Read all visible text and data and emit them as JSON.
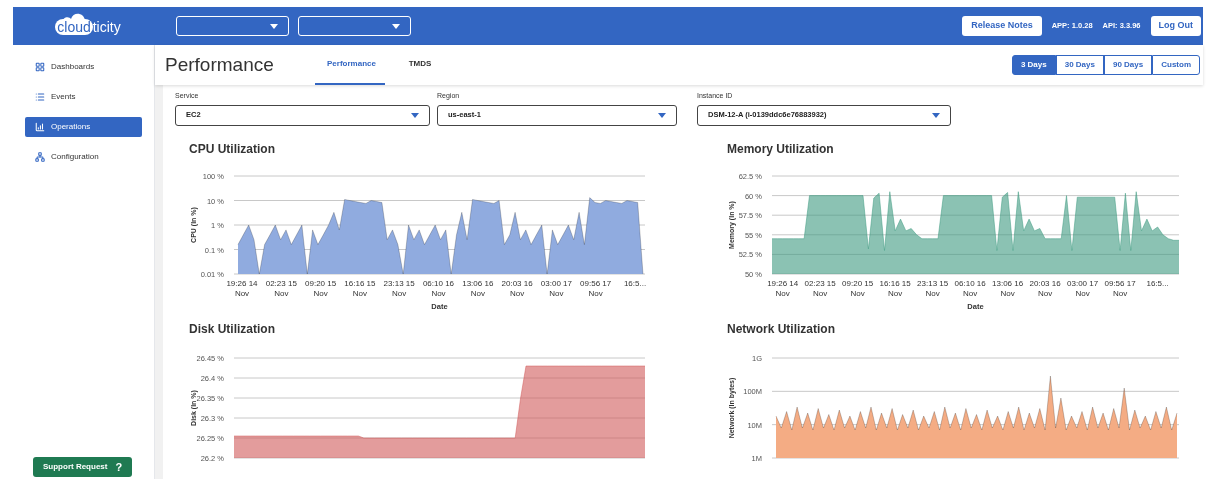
{
  "header": {
    "logo_parts": [
      "cloud",
      "ticity"
    ],
    "release_notes": "Release Notes",
    "app_version": "APP: 1.0.28",
    "api_version": "API: 3.3.96",
    "logout": "Log Out"
  },
  "sidebar": {
    "items": [
      {
        "label": "Dashboards",
        "selected": false
      },
      {
        "label": "Events",
        "selected": false
      },
      {
        "label": "Operations",
        "selected": true
      },
      {
        "label": "Configuration",
        "selected": false
      }
    ],
    "support": {
      "label": "Support Request",
      "icon_text": "?"
    }
  },
  "page": {
    "title": "Performance",
    "tabs": [
      {
        "label": "Performance",
        "selected": true
      },
      {
        "label": "TMDS",
        "selected": false
      }
    ],
    "ranges": [
      {
        "label": "3 Days",
        "selected": true
      },
      {
        "label": "30 Days",
        "selected": false
      },
      {
        "label": "90 Days",
        "selected": false
      },
      {
        "label": "Custom",
        "selected": false
      }
    ]
  },
  "filters": [
    {
      "label": "Service",
      "value": "EC2"
    },
    {
      "label": "Region",
      "value": "us-east-1"
    },
    {
      "label": "Instance ID",
      "value": "DSM-12-A (i-0139ddc6e76883932)"
    }
  ],
  "charts": [
    {
      "kind": "log_chart",
      "title": "CPU Utilization",
      "xlabel": "Date",
      "ylabel": "CPU (In %)",
      "color": "#90abdf",
      "yticks": [
        "100 %",
        "10 %",
        "1 %",
        "0.1 %",
        "0.01 %"
      ],
      "xticks": [
        "19:26 14 Nov",
        "02:23 15 Nov",
        "09:20 15 Nov",
        "16:16 15 Nov",
        "23:13 15 Nov",
        "06:10 16 Nov",
        "13:06 16 Nov",
        "20:03 16 Nov",
        "03:00 17 Nov",
        "09:56 17 Nov",
        "16:5..."
      ]
    },
    {
      "kind": "data_chart",
      "title": "Memory Utilization",
      "chart_data": {
        "type": "area",
        "xlabel": "Date",
        "ylabel": "Memory (In %)",
        "grid": true,
        "ylim": [
          50,
          62.5
        ],
        "categories": [
          null,
          null,
          "19:26 14 Nov",
          null,
          null,
          null,
          null,
          null,
          null,
          "02:23 15 Nov",
          null,
          null,
          null,
          null,
          null,
          null,
          "09:20 15 Nov",
          null,
          null,
          null,
          null,
          null,
          null,
          "16:16 15 Nov",
          null,
          null,
          null,
          null,
          null,
          null,
          "23:13 15 Nov",
          null,
          null,
          null,
          null,
          null,
          null,
          "06:10 16 Nov",
          null,
          null,
          null,
          null,
          null,
          null,
          "13:06 16 Nov",
          null,
          null,
          null,
          null,
          null,
          null,
          "20:03 16 Nov",
          null,
          null,
          null,
          null,
          null,
          null,
          "03:00 17 Nov",
          null,
          null,
          null,
          null,
          null,
          null,
          "09:56 17 Nov",
          null,
          null,
          null,
          null,
          null,
          null,
          "16:5...",
          null,
          null,
          null,
          null
        ],
        "yticks": [
          {
            "value": 50,
            "label": "50 %"
          },
          {
            "value": 52.5,
            "label": "52.5 %"
          },
          {
            "value": 55,
            "label": "55 %"
          },
          {
            "value": 57.5,
            "label": "57.5 %"
          },
          {
            "value": 60,
            "label": "60 %"
          },
          {
            "value": 62.5,
            "label": "62.5 %"
          }
        ],
        "series": [
          {
            "color": "#3e9a80",
            "values": [
              54.5,
              54.5,
              54.5,
              54.5,
              54.5,
              54.5,
              54.5,
              60,
              60,
              60,
              60,
              60,
              60,
              60,
              60,
              60,
              60,
              60,
              53.2,
              59.7,
              60.3,
              53,
              60.5,
              55.5,
              57,
              55.5,
              55.8,
              55,
              54.5,
              54.5,
              54.5,
              54.5,
              60,
              60,
              60,
              60,
              60,
              60,
              60,
              60,
              60,
              60,
              53,
              59.8,
              60.4,
              53,
              60.5,
              55.5,
              57,
              55.5,
              55.8,
              54.5,
              54.5,
              54.5,
              54.5,
              60,
              53,
              59.8,
              59.8,
              59.8,
              59.8,
              59.8,
              59.8,
              59.8,
              59.8,
              53,
              60.3,
              53,
              60.5,
              55.5,
              57,
              55.5,
              56,
              55,
              54.5,
              54.3,
              54.3
            ]
          }
        ]
      }
    },
    {
      "kind": "data_chart",
      "title": "Disk Utilization",
      "chart_data": {
        "type": "area",
        "ylabel": "Disk (In %)",
        "grid": true,
        "ylim": [
          26.2,
          26.45
        ],
        "categories": [
          null,
          null,
          null,
          null,
          null,
          null,
          null,
          null,
          null,
          null,
          null,
          null,
          null,
          null,
          null,
          null,
          null,
          null,
          null,
          null,
          null,
          null,
          null,
          null,
          null,
          null,
          null,
          null,
          null,
          null,
          null,
          null,
          null,
          null,
          null,
          null,
          null,
          null,
          null,
          null,
          null,
          null,
          null,
          null,
          null,
          null,
          null,
          null,
          null,
          null,
          null,
          null,
          null,
          null,
          null,
          null,
          null,
          null,
          null,
          null,
          null,
          null,
          null,
          null,
          null,
          null,
          null,
          null,
          null,
          null,
          null,
          null,
          null,
          null,
          null,
          null,
          null
        ],
        "yticks": [
          {
            "value": 26.2,
            "label": "26.2 %"
          },
          {
            "value": 26.25,
            "label": "26.25 %"
          },
          {
            "value": 26.3,
            "label": "26.3 %"
          },
          {
            "value": 26.35,
            "label": "26.35 %"
          },
          {
            "value": 26.4,
            "label": "26.4 %"
          },
          {
            "value": 26.45,
            "label": "26.45 %"
          }
        ],
        "series": [
          {
            "color": "#d05a5a",
            "values": [
              26.255,
              26.255,
              26.255,
              26.255,
              26.255,
              26.255,
              26.255,
              26.255,
              26.255,
              26.255,
              26.255,
              26.255,
              26.255,
              26.255,
              26.255,
              26.255,
              26.255,
              26.255,
              26.255,
              26.255,
              26.255,
              26.255,
              26.255,
              26.255,
              26.25,
              26.25,
              26.25,
              26.25,
              26.25,
              26.25,
              26.25,
              26.25,
              26.25,
              26.25,
              26.25,
              26.25,
              26.25,
              26.25,
              26.25,
              26.25,
              26.25,
              26.25,
              26.25,
              26.25,
              26.25,
              26.25,
              26.25,
              26.25,
              26.25,
              26.25,
              26.25,
              26.25,
              26.25,
              26.35,
              26.43,
              26.43,
              26.43,
              26.43,
              26.43,
              26.43,
              26.43,
              26.43,
              26.43,
              26.43,
              26.43,
              26.43,
              26.43,
              26.43,
              26.43,
              26.43,
              26.43,
              26.43,
              26.43,
              26.43,
              26.43,
              26.43,
              26.43
            ]
          }
        ]
      }
    },
    {
      "kind": "log_chart",
      "title": "Network Utilization",
      "ylabel": "Network (In bytes)",
      "color": "#f4ac84",
      "yticks": [
        "1G",
        "100M",
        "10M",
        "1M"
      ]
    }
  ]
}
